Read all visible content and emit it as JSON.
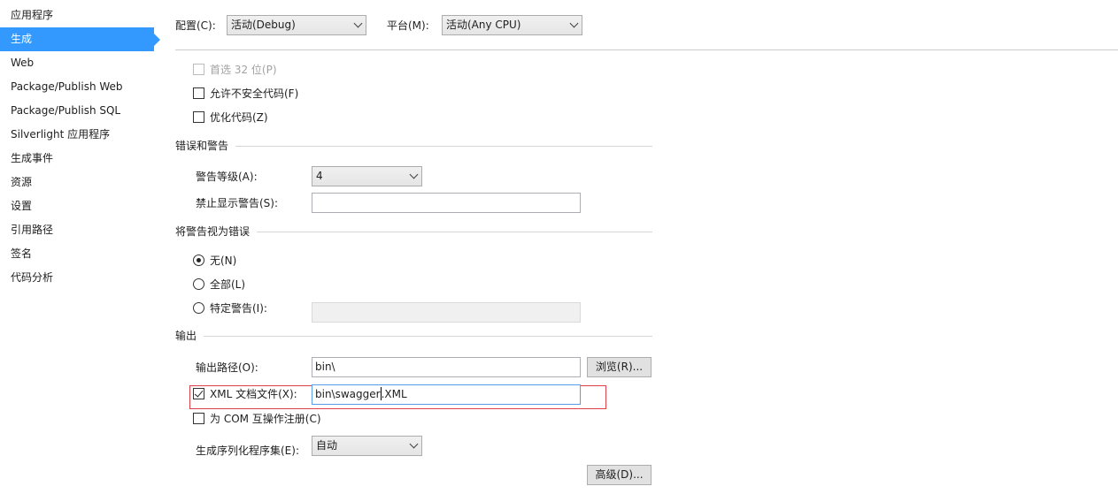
{
  "sidebar": {
    "items": [
      {
        "label": "应用程序"
      },
      {
        "label": "生成",
        "active": true
      },
      {
        "label": "Web"
      },
      {
        "label": "Package/Publish Web"
      },
      {
        "label": "Package/Publish SQL"
      },
      {
        "label": "Silverlight 应用程序"
      },
      {
        "label": "生成事件"
      },
      {
        "label": "资源"
      },
      {
        "label": "设置"
      },
      {
        "label": "引用路径"
      },
      {
        "label": "签名"
      },
      {
        "label": "代码分析"
      }
    ]
  },
  "header": {
    "config_label": "配置(C):",
    "config_value": "活动(Debug)",
    "platform_label": "平台(M):",
    "platform_value": "活动(Any CPU)"
  },
  "general": {
    "prefer32_label": "首选 32 位(P)",
    "prefer32_checked": false,
    "prefer32_disabled": true,
    "unsafe_label": "允许不安全代码(F)",
    "unsafe_checked": false,
    "optimize_label": "优化代码(Z)",
    "optimize_checked": false
  },
  "errors": {
    "title": "错误和警告",
    "warning_level_label": "警告等级(A):",
    "warning_level_value": "4",
    "suppress_label": "禁止显示警告(S):",
    "suppress_value": ""
  },
  "treat_warnings": {
    "title": "将警告视为错误",
    "none_label": "无(N)",
    "all_label": "全部(L)",
    "specific_label": "特定警告(I):",
    "selected": "none",
    "specific_value": ""
  },
  "output": {
    "title": "输出",
    "path_label": "输出路径(O):",
    "path_value": "bin\\",
    "browse_label": "浏览(R)...",
    "xmldoc_label": "XML 文档文件(X):",
    "xmldoc_checked": true,
    "xmldoc_value_before_caret": "bin\\swagger",
    "xmldoc_value_after_caret": ".XML",
    "com_label": "为 COM 互操作注册(C)",
    "com_checked": false,
    "serialization_label": "生成序列化程序集(E):",
    "serialization_value": "自动",
    "advanced_label": "高级(D)..."
  },
  "colors": {
    "sidebar_active": "#3399ff",
    "highlight_border": "#e0404a"
  }
}
